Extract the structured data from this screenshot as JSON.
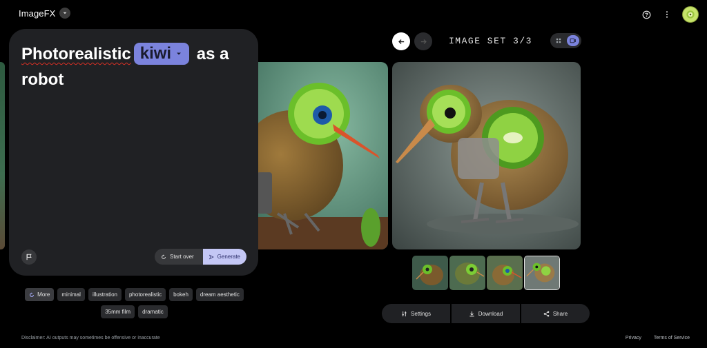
{
  "header": {
    "brand": "ImageFX",
    "help_icon": "help-circle-icon",
    "more_icon": "more-vert-icon",
    "avatar_icon": "avatar-icon"
  },
  "prompt": {
    "word1": "Photorealistic",
    "chip": "kiwi",
    "rest": "as a robot",
    "start_over": "Start over",
    "generate": "Generate"
  },
  "chips": [
    "More",
    "minimal",
    "illustration",
    "photorealistic",
    "bokeh",
    "dream aesthetic",
    "35mm film",
    "dramatic"
  ],
  "image_set": {
    "label": "IMAGE SET 3/3"
  },
  "actions": {
    "settings": "Settings",
    "download": "Download",
    "share": "Share"
  },
  "footer": {
    "disclaimer": "Disclaimer: AI outputs may sometimes be offensive or inaccurate",
    "privacy": "Privacy",
    "terms": "Terms of Service"
  },
  "colors": {
    "accent": "#7b83dd",
    "generate_bg": "#c4c7f5",
    "card_bg": "#202124",
    "kiwi_green": "#6bbf2a"
  }
}
